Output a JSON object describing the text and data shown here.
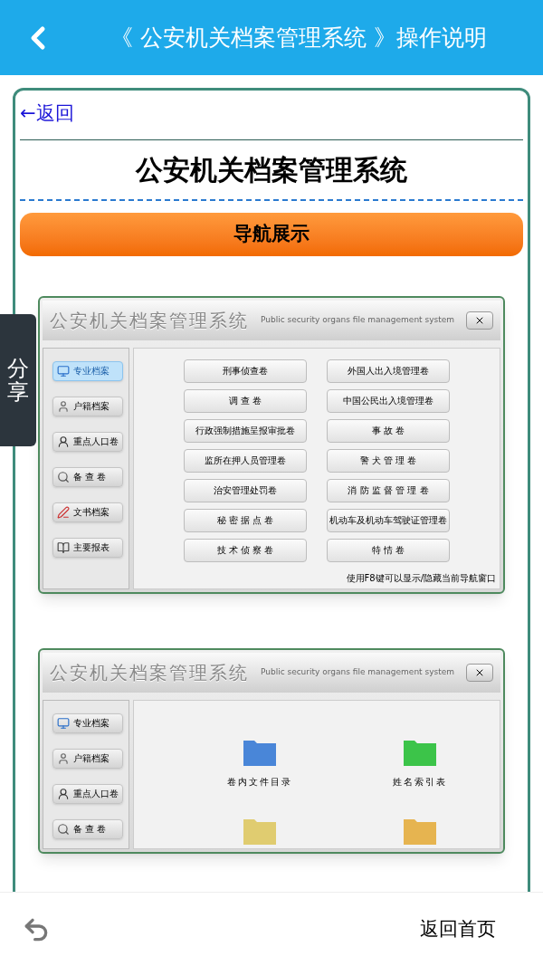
{
  "header": {
    "title": "《 公安机关档案管理系统 》操作说明"
  },
  "back_link": "←返回",
  "page_title": "公安机关档案管理系统",
  "nav_button": "导航展示",
  "windows": [
    {
      "kind": "buttons",
      "title": "公安机关档案管理系统",
      "subtitle": "Public security organs file management system",
      "sidebar": [
        {
          "label": "专业档案",
          "selected": true
        },
        {
          "label": "户籍档案",
          "selected": false
        },
        {
          "label": "重点人口卷",
          "selected": false
        },
        {
          "label": "备 查 卷",
          "selected": false
        },
        {
          "label": "文书档案",
          "selected": false
        },
        {
          "label": "主要报表",
          "selected": false
        }
      ],
      "buttons": [
        "刑事侦查卷",
        "外国人出入境管理卷",
        "调 查 卷",
        "中国公民出入境管理卷",
        "行政强制措施呈报审批卷",
        "事 故 卷",
        "监所在押人员管理卷",
        "警 犬 管 理 卷",
        "治安管理处罚卷",
        "消 防 监 督 管 理 卷",
        "秘 密 据 点 卷",
        "机动车及机动车驾驶证管理卷",
        "技 术 侦 察 卷",
        "特 情 卷"
      ],
      "hint": "使用F8键可以显示/隐藏当前导航窗口"
    },
    {
      "kind": "folders",
      "title": "公安机关档案管理系统",
      "subtitle": "Public security organs file management system",
      "sidebar": [
        {
          "label": "专业档案",
          "selected": false
        },
        {
          "label": "户籍档案",
          "selected": false
        },
        {
          "label": "重点人口卷",
          "selected": false
        },
        {
          "label": "备 查 卷",
          "selected": false
        }
      ],
      "folders": [
        {
          "label": "卷内文件目录",
          "color": "#4a86d8"
        },
        {
          "label": "姓名索引表",
          "color": "#3cc44a"
        },
        {
          "color": "#e0cc70"
        },
        {
          "color": "#e6b450"
        }
      ]
    }
  ],
  "share_tab": {
    "label": "分享"
  },
  "bottom_bar": {
    "home_label": "返回首页"
  }
}
